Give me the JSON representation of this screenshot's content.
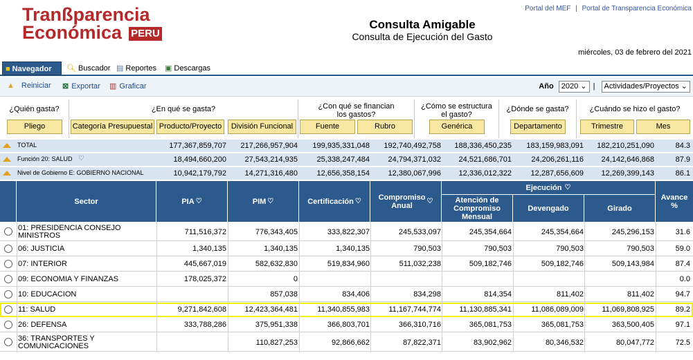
{
  "header": {
    "logo_line1": "Tranßparencia",
    "logo_line2": "Económica",
    "logo_badge": "PERU",
    "link_mef": "Portal del MEF",
    "link_sep": "|",
    "link_te": "Portal de Transparencia Económica",
    "title": "Consulta Amigable",
    "subtitle": "Consulta de Ejecución del Gasto",
    "date": "miércoles, 03 de febrero del 2021"
  },
  "tabs": [
    {
      "label": "Navegador"
    },
    {
      "label": "Buscador"
    },
    {
      "label": "Reportes"
    },
    {
      "label": "Descargas"
    }
  ],
  "toolbar": {
    "reiniciar": "Reiniciar",
    "exportar": "Exportar",
    "graficar": "Graficar",
    "year_label": "Año",
    "year_value": "2020",
    "type_sep": "|",
    "type_value": "Actividades/Proyectos"
  },
  "filters": {
    "q1": "¿Quién gasta?",
    "q2": "¿En qué se gasta?",
    "q3": "¿Con qué se financian los gastos?",
    "q4": "¿Cómo se estructura el gasto?",
    "q5": "¿Dónde se gasta?",
    "q6": "¿Cuándo se hizo el gasto?",
    "b_pliego": "Pliego",
    "b_categoria": "Categoría Presupuestal",
    "b_producto": "Producto/Proyecto",
    "b_division": "División Funcional",
    "b_fuente": "Fuente",
    "b_rubro": "Rubro",
    "b_generica": "Genérica",
    "b_departamento": "Departamento",
    "b_trimestre": "Trimestre",
    "b_mes": "Mes"
  },
  "summary": [
    {
      "label": "TOTAL",
      "pia": "177,367,859,707",
      "pim": "217,266,957,904",
      "cert": "199,935,331,048",
      "comp": "192,740,492,758",
      "aten": "188,336,450,235",
      "dev": "183,159,983,091",
      "gir": "182,210,251,090",
      "av": "84.3"
    },
    {
      "label": "Función 20: SALUD",
      "pia": "18,494,660,200",
      "pim": "27,543,214,935",
      "cert": "25,338,247,484",
      "comp": "24,794,371,032",
      "aten": "24,521,686,701",
      "dev": "24,206,261,116",
      "gir": "24,142,646,868",
      "av": "87.9"
    },
    {
      "label": "Nivel de Gobierno E: GOBIERNO NACIONAL",
      "pia": "10,942,179,792",
      "pim": "14,271,316,480",
      "cert": "12,656,358,154",
      "comp": "12,380,067,996",
      "aten": "12,336,012,322",
      "dev": "12,287,656,609",
      "gir": "12,269,399,143",
      "av": "86.1"
    }
  ],
  "columns": {
    "sector": "Sector",
    "pia": "PIA",
    "pim": "PIM",
    "cert": "Certificación",
    "comp": "Compromiso Anual",
    "ejec": "Ejecución",
    "aten": "Atención de Compromiso Mensual",
    "dev": "Devengado",
    "gir": "Girado",
    "av": "Avance %"
  },
  "rows": [
    {
      "name": "01: PRESIDENCIA CONSEJO MINISTROS",
      "pia": "711,516,372",
      "pim": "776,343,405",
      "cert": "333,822,307",
      "comp": "245,533,097",
      "aten": "245,354,664",
      "dev": "245,354,664",
      "gir": "245,296,153",
      "av": "31.6"
    },
    {
      "name": "06: JUSTICIA",
      "pia": "1,340,135",
      "pim": "1,340,135",
      "cert": "1,340,135",
      "comp": "790,503",
      "aten": "790,503",
      "dev": "790,503",
      "gir": "790,503",
      "av": "59.0"
    },
    {
      "name": "07: INTERIOR",
      "pia": "445,667,019",
      "pim": "582,632,830",
      "cert": "519,834,960",
      "comp": "511,032,238",
      "aten": "509,182,746",
      "dev": "509,182,746",
      "gir": "509,143,984",
      "av": "87.4"
    },
    {
      "name": "09: ECONOMIA Y FINANZAS",
      "pia": "178,025,372",
      "pim": "0",
      "cert": "",
      "comp": "",
      "aten": "",
      "dev": "",
      "gir": "",
      "av": "0.0"
    },
    {
      "name": "10: EDUCACION",
      "pia": "",
      "pim": "857,038",
      "cert": "834,406",
      "comp": "834,298",
      "aten": "814,354",
      "dev": "811,402",
      "gir": "811,402",
      "av": "94.7"
    },
    {
      "name": "11: SALUD",
      "pia": "9,271,842,608",
      "pim": "12,423,364,481",
      "cert": "11,340,855,983",
      "comp": "11,167,744,774",
      "aten": "11,130,885,341",
      "dev": "11,086,089,009",
      "gir": "11,069,808,925",
      "av": "89.2"
    },
    {
      "name": "26: DEFENSA",
      "pia": "333,788,286",
      "pim": "375,951,338",
      "cert": "366,803,701",
      "comp": "366,310,716",
      "aten": "365,081,753",
      "dev": "365,081,753",
      "gir": "363,500,405",
      "av": "97.1"
    },
    {
      "name": "36: TRANSPORTES Y COMUNICACIONES",
      "pia": "",
      "pim": "110,827,253",
      "cert": "92,866,662",
      "comp": "87,822,371",
      "aten": "83,902,962",
      "dev": "80,346,532",
      "gir": "80,047,772",
      "av": "72.5"
    }
  ]
}
